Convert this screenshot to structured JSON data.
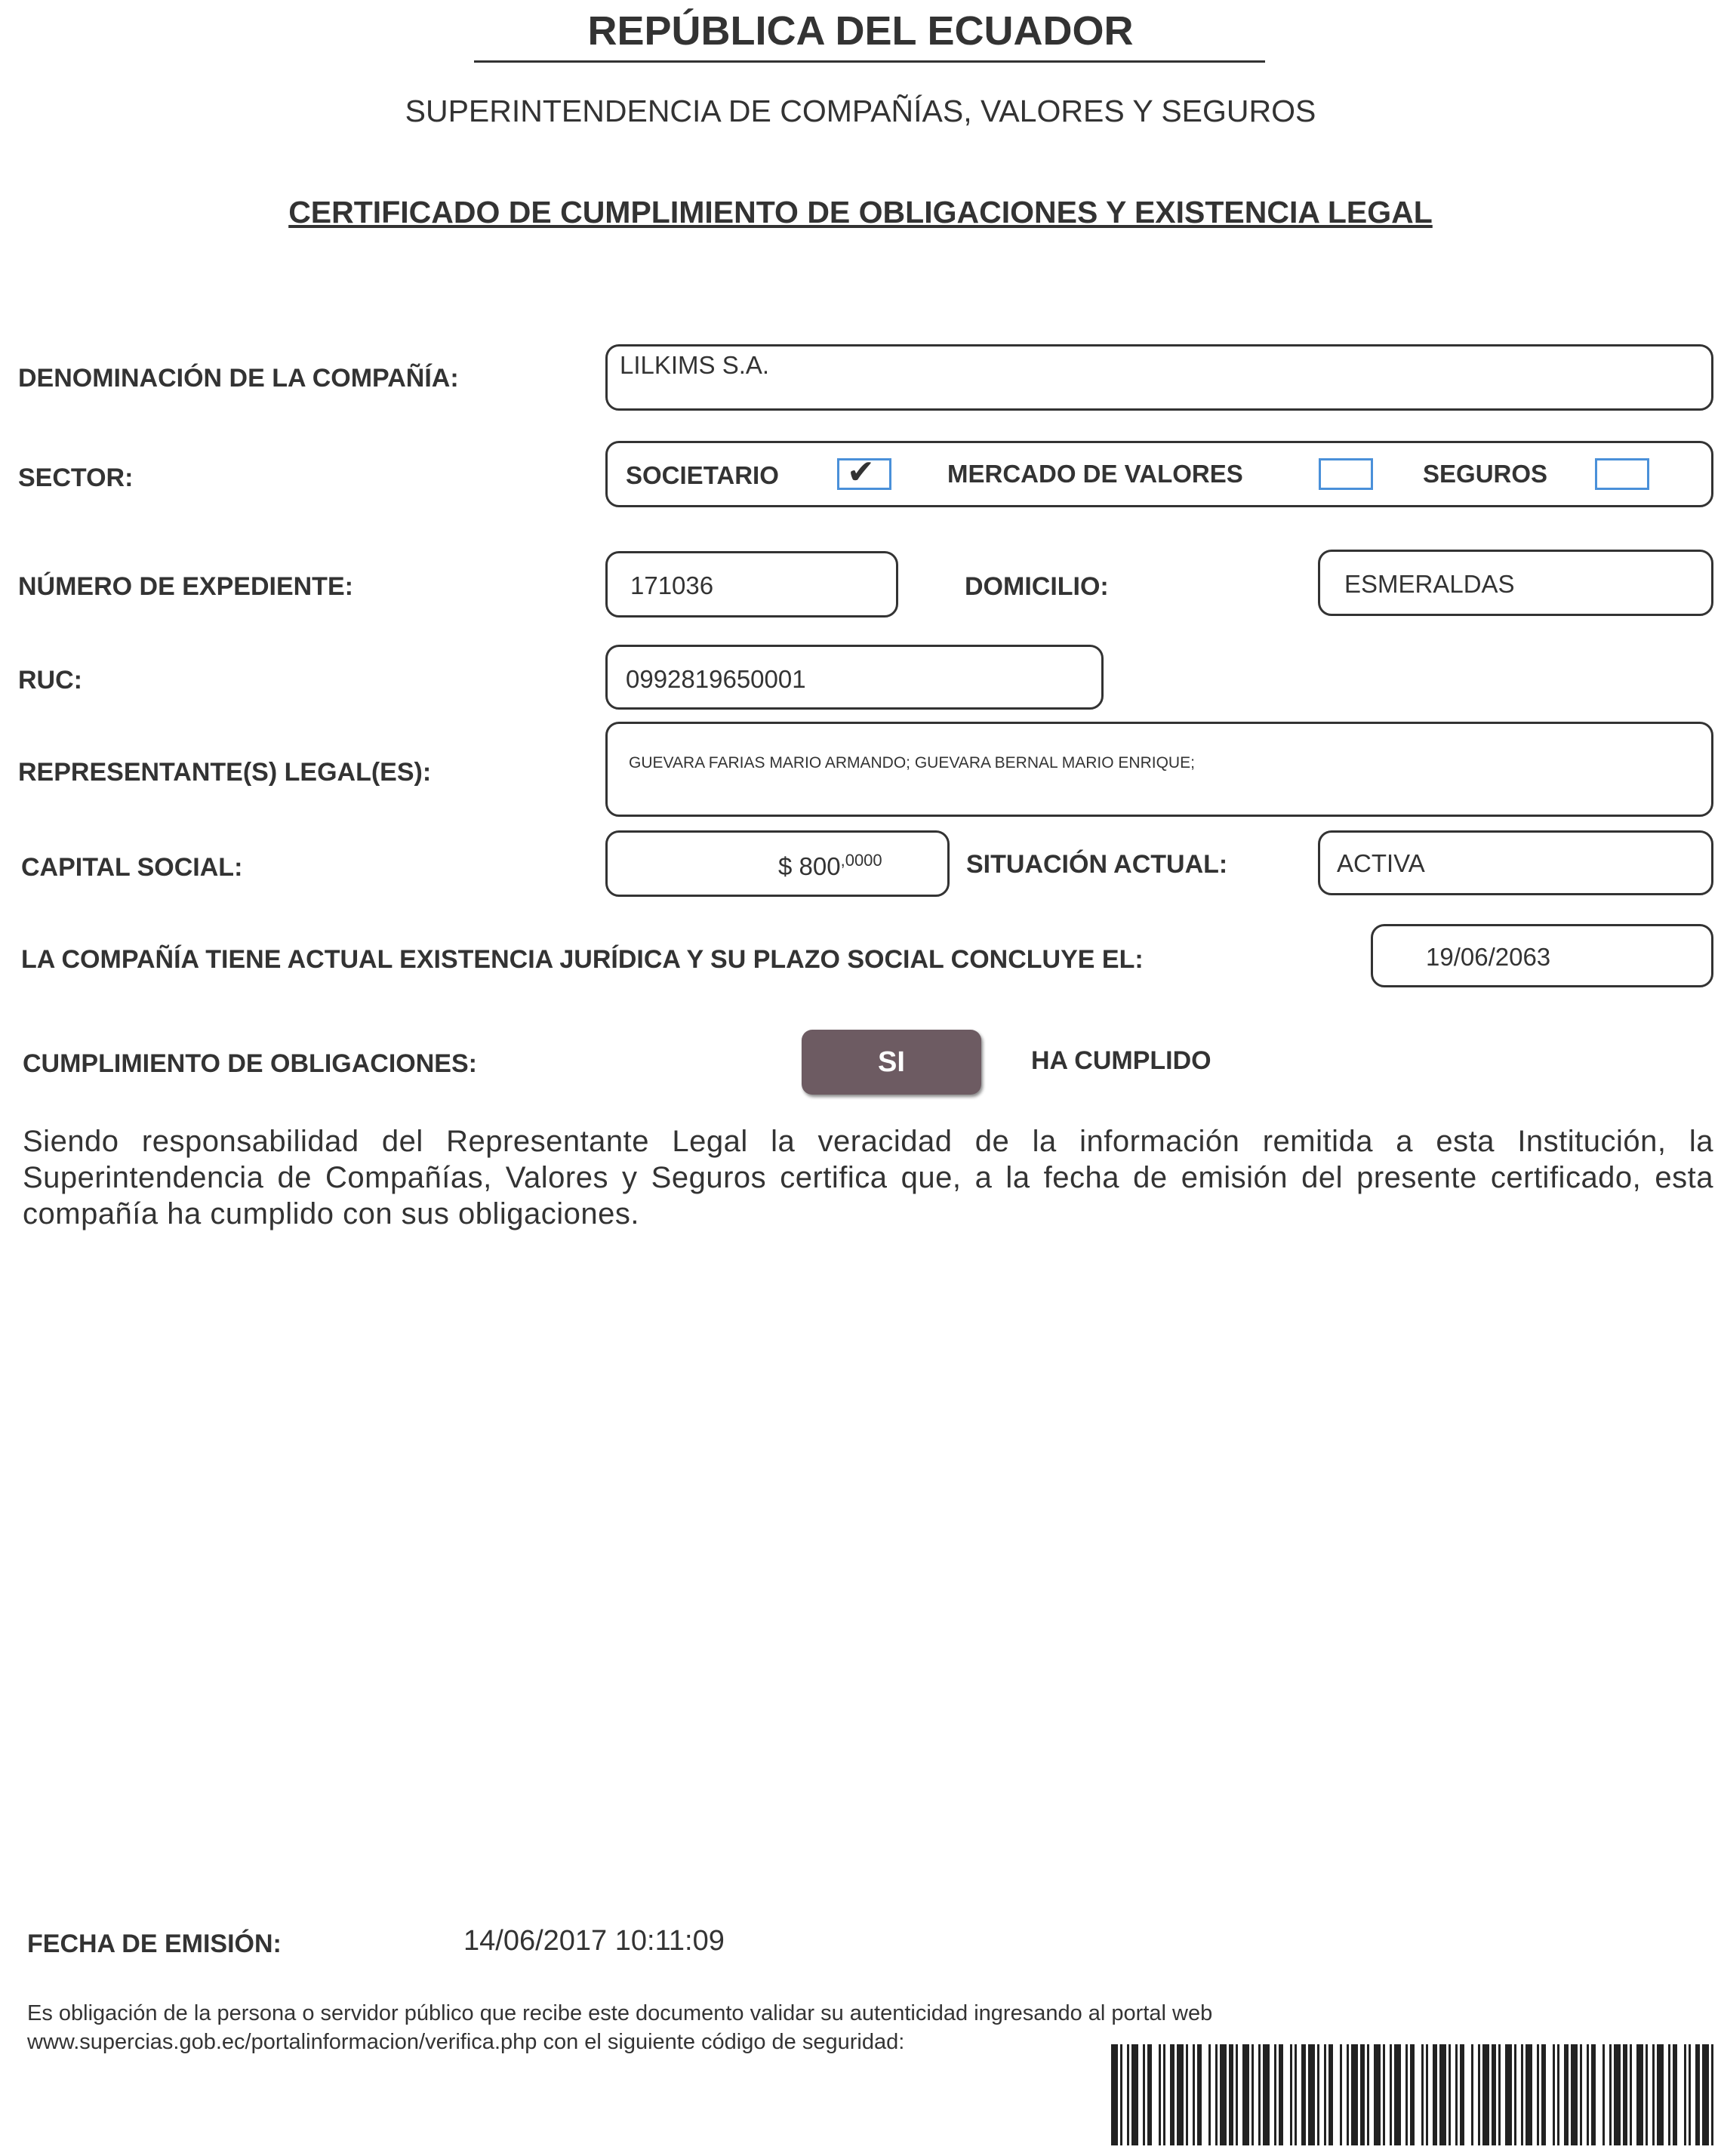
{
  "header": {
    "country": "REPÚBLICA DEL ECUADOR",
    "agency": "SUPERINTENDENCIA DE COMPAÑÍAS, VALORES Y SEGUROS",
    "certificate_title": "CERTIFICADO DE CUMPLIMIENTO DE OBLIGACIONES Y EXISTENCIA LEGAL"
  },
  "fields": {
    "company_name": {
      "label": "DENOMINACIÓN DE LA COMPAÑÍA:",
      "value": "LILKIMS S.A."
    },
    "sector": {
      "label": "SECTOR:",
      "options": [
        {
          "label": "SOCIETARIO",
          "checked": true
        },
        {
          "label": "MERCADO DE VALORES",
          "checked": false
        },
        {
          "label": "SEGUROS",
          "checked": false
        }
      ],
      "check_mark": "✔"
    },
    "file_number": {
      "label": "NÚMERO DE EXPEDIENTE:",
      "value": "171036"
    },
    "domicile": {
      "label": "DOMICILIO:",
      "value": "ESMERALDAS"
    },
    "ruc": {
      "label": "RUC:",
      "value": "0992819650001"
    },
    "legal_reps": {
      "label": "REPRESENTANTE(S) LEGAL(ES):",
      "value": "GUEVARA FARIAS MARIO ARMANDO; GUEVARA BERNAL MARIO ENRIQUE;"
    },
    "capital": {
      "label": "CAPITAL SOCIAL:",
      "value_main": "$ 800",
      "value_decimals": ",0000"
    },
    "status": {
      "label": "SITUACIÓN ACTUAL:",
      "value": "ACTIVA"
    },
    "term": {
      "label": "LA COMPAÑÍA TIENE ACTUAL EXISTENCIA JURÍDICA Y SU PLAZO SOCIAL CONCLUYE EL:",
      "value": "19/06/2063"
    },
    "compliance": {
      "label": "CUMPLIMIENTO DE OBLIGACIONES:",
      "button": "SI",
      "result": "HA CUMPLIDO"
    }
  },
  "statement": "Siendo responsabilidad del Representante Legal la veracidad de la información remitida a esta Institución, la Superintendencia de Compañías, Valores y Seguros certifica que, a la fecha de emisión del presente certificado, esta compañía ha cumplido con sus obligaciones.",
  "issue": {
    "label": "FECHA DE EMISIÓN:",
    "value": "14/06/2017 10:11:09"
  },
  "footer_note": {
    "line1": "Es obligación de la persona o servidor público que recibe este documento validar su autenticidad ingresando al portal web",
    "line2": "www.supercias.gob.ec/portalinformacion/verifica.php con el siguiente código de seguridad:"
  },
  "colors": {
    "checkbox_border": "#4a90d9",
    "si_button": "#6d5b62",
    "ink": "#333333"
  }
}
